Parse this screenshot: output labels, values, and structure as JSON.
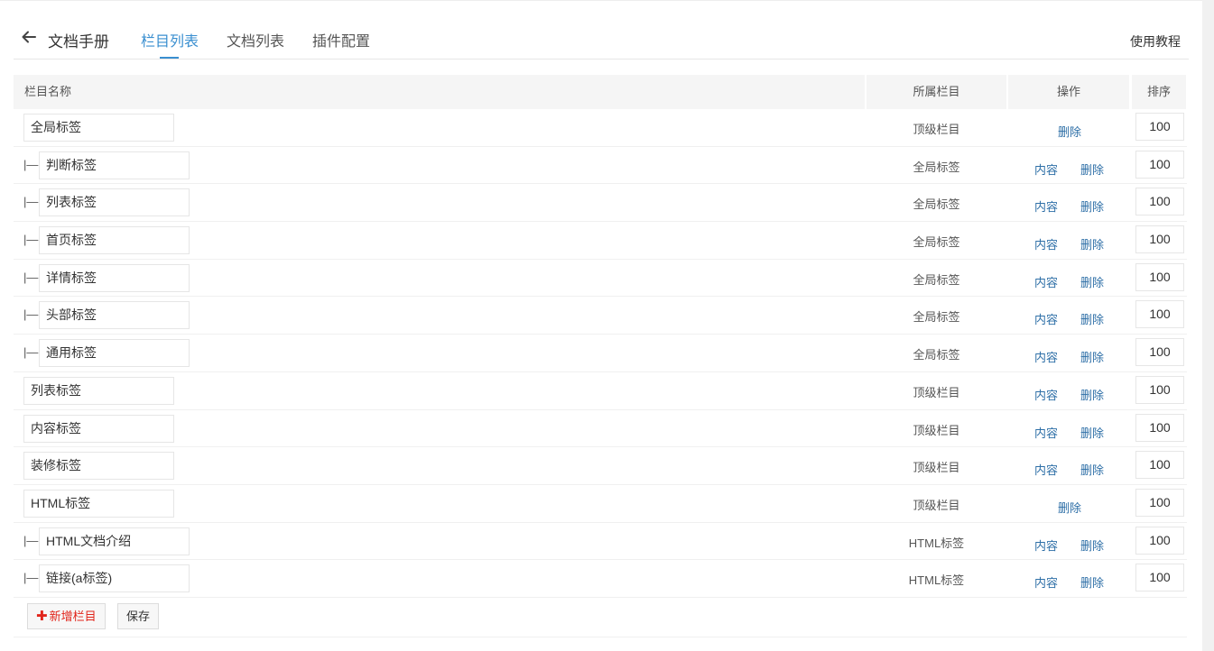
{
  "header": {
    "title": "文档手册",
    "tabs": [
      {
        "label": "栏目列表",
        "active": true
      },
      {
        "label": "文档列表",
        "active": false
      },
      {
        "label": "插件配置",
        "active": false
      }
    ],
    "tutorial_label": "使用教程"
  },
  "table": {
    "columns": {
      "name": "栏目名称",
      "parent": "所属栏目",
      "ops": "操作",
      "sort": "排序"
    },
    "prefix": "|—",
    "content_label": "内容",
    "delete_label": "删除",
    "rows": [
      {
        "name": "全局标签",
        "child": false,
        "parent": "顶级栏目",
        "has_content": false,
        "sort": "100"
      },
      {
        "name": "判断标签",
        "child": true,
        "parent": "全局标签",
        "has_content": true,
        "sort": "100"
      },
      {
        "name": "列表标签",
        "child": true,
        "parent": "全局标签",
        "has_content": true,
        "sort": "100"
      },
      {
        "name": "首页标签",
        "child": true,
        "parent": "全局标签",
        "has_content": true,
        "sort": "100"
      },
      {
        "name": "详情标签",
        "child": true,
        "parent": "全局标签",
        "has_content": true,
        "sort": "100"
      },
      {
        "name": "头部标签",
        "child": true,
        "parent": "全局标签",
        "has_content": true,
        "sort": "100"
      },
      {
        "name": "通用标签",
        "child": true,
        "parent": "全局标签",
        "has_content": true,
        "sort": "100"
      },
      {
        "name": "列表标签",
        "child": false,
        "parent": "顶级栏目",
        "has_content": true,
        "sort": "100"
      },
      {
        "name": "内容标签",
        "child": false,
        "parent": "顶级栏目",
        "has_content": true,
        "sort": "100"
      },
      {
        "name": "装修标签",
        "child": false,
        "parent": "顶级栏目",
        "has_content": true,
        "sort": "100"
      },
      {
        "name": "HTML标签",
        "child": false,
        "parent": "顶级栏目",
        "has_content": false,
        "sort": "100"
      },
      {
        "name": "HTML文档介绍",
        "child": true,
        "parent": "HTML标签",
        "has_content": true,
        "sort": "100"
      },
      {
        "name": "链接(a标签)",
        "child": true,
        "parent": "HTML标签",
        "has_content": true,
        "sort": "100"
      }
    ]
  },
  "footer": {
    "add_label": "新增栏目",
    "add_icon_glyph": "✚",
    "save_label": "保存"
  },
  "colors": {
    "accent": "#3a8fd0",
    "link": "#2e6fa7",
    "danger": "#e1251b"
  }
}
